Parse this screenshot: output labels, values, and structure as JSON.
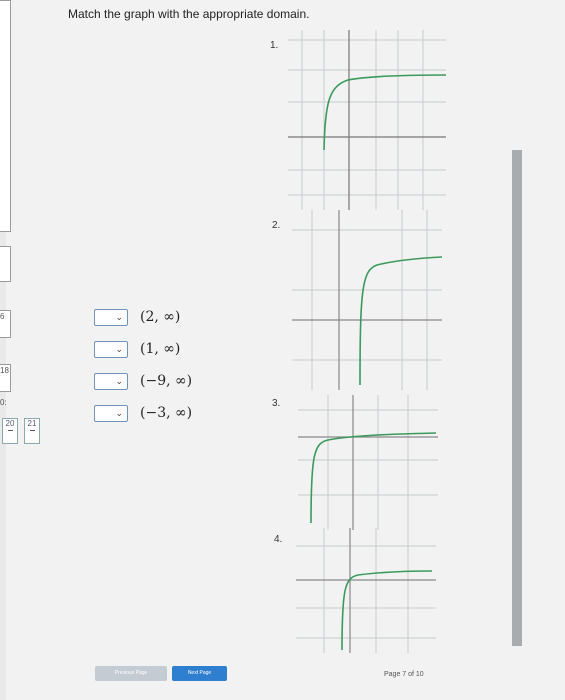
{
  "instruction": "Match the graph with the appropriate domain.",
  "answers": [
    {
      "label": "(2, ∞)"
    },
    {
      "label": "(1, ∞)"
    },
    {
      "label": "(−9, ∞)"
    },
    {
      "label": "(−3, ∞)"
    }
  ],
  "graphs": [
    {
      "number": "1."
    },
    {
      "number": "2."
    },
    {
      "number": "3."
    },
    {
      "number": "4."
    }
  ],
  "sidebar": {
    "items": [
      "6",
      "18",
      "0:",
      "20",
      "21"
    ]
  },
  "nav": {
    "previous": "Previous Page",
    "next": "Next Page",
    "page_indicator": "Page 7 of 10"
  },
  "colors": {
    "curve": "#3a9a5a",
    "accent": "#2f7fd0",
    "select_border": "#6e95b8"
  },
  "icons": {
    "dropdown": "chevron-down-icon"
  }
}
